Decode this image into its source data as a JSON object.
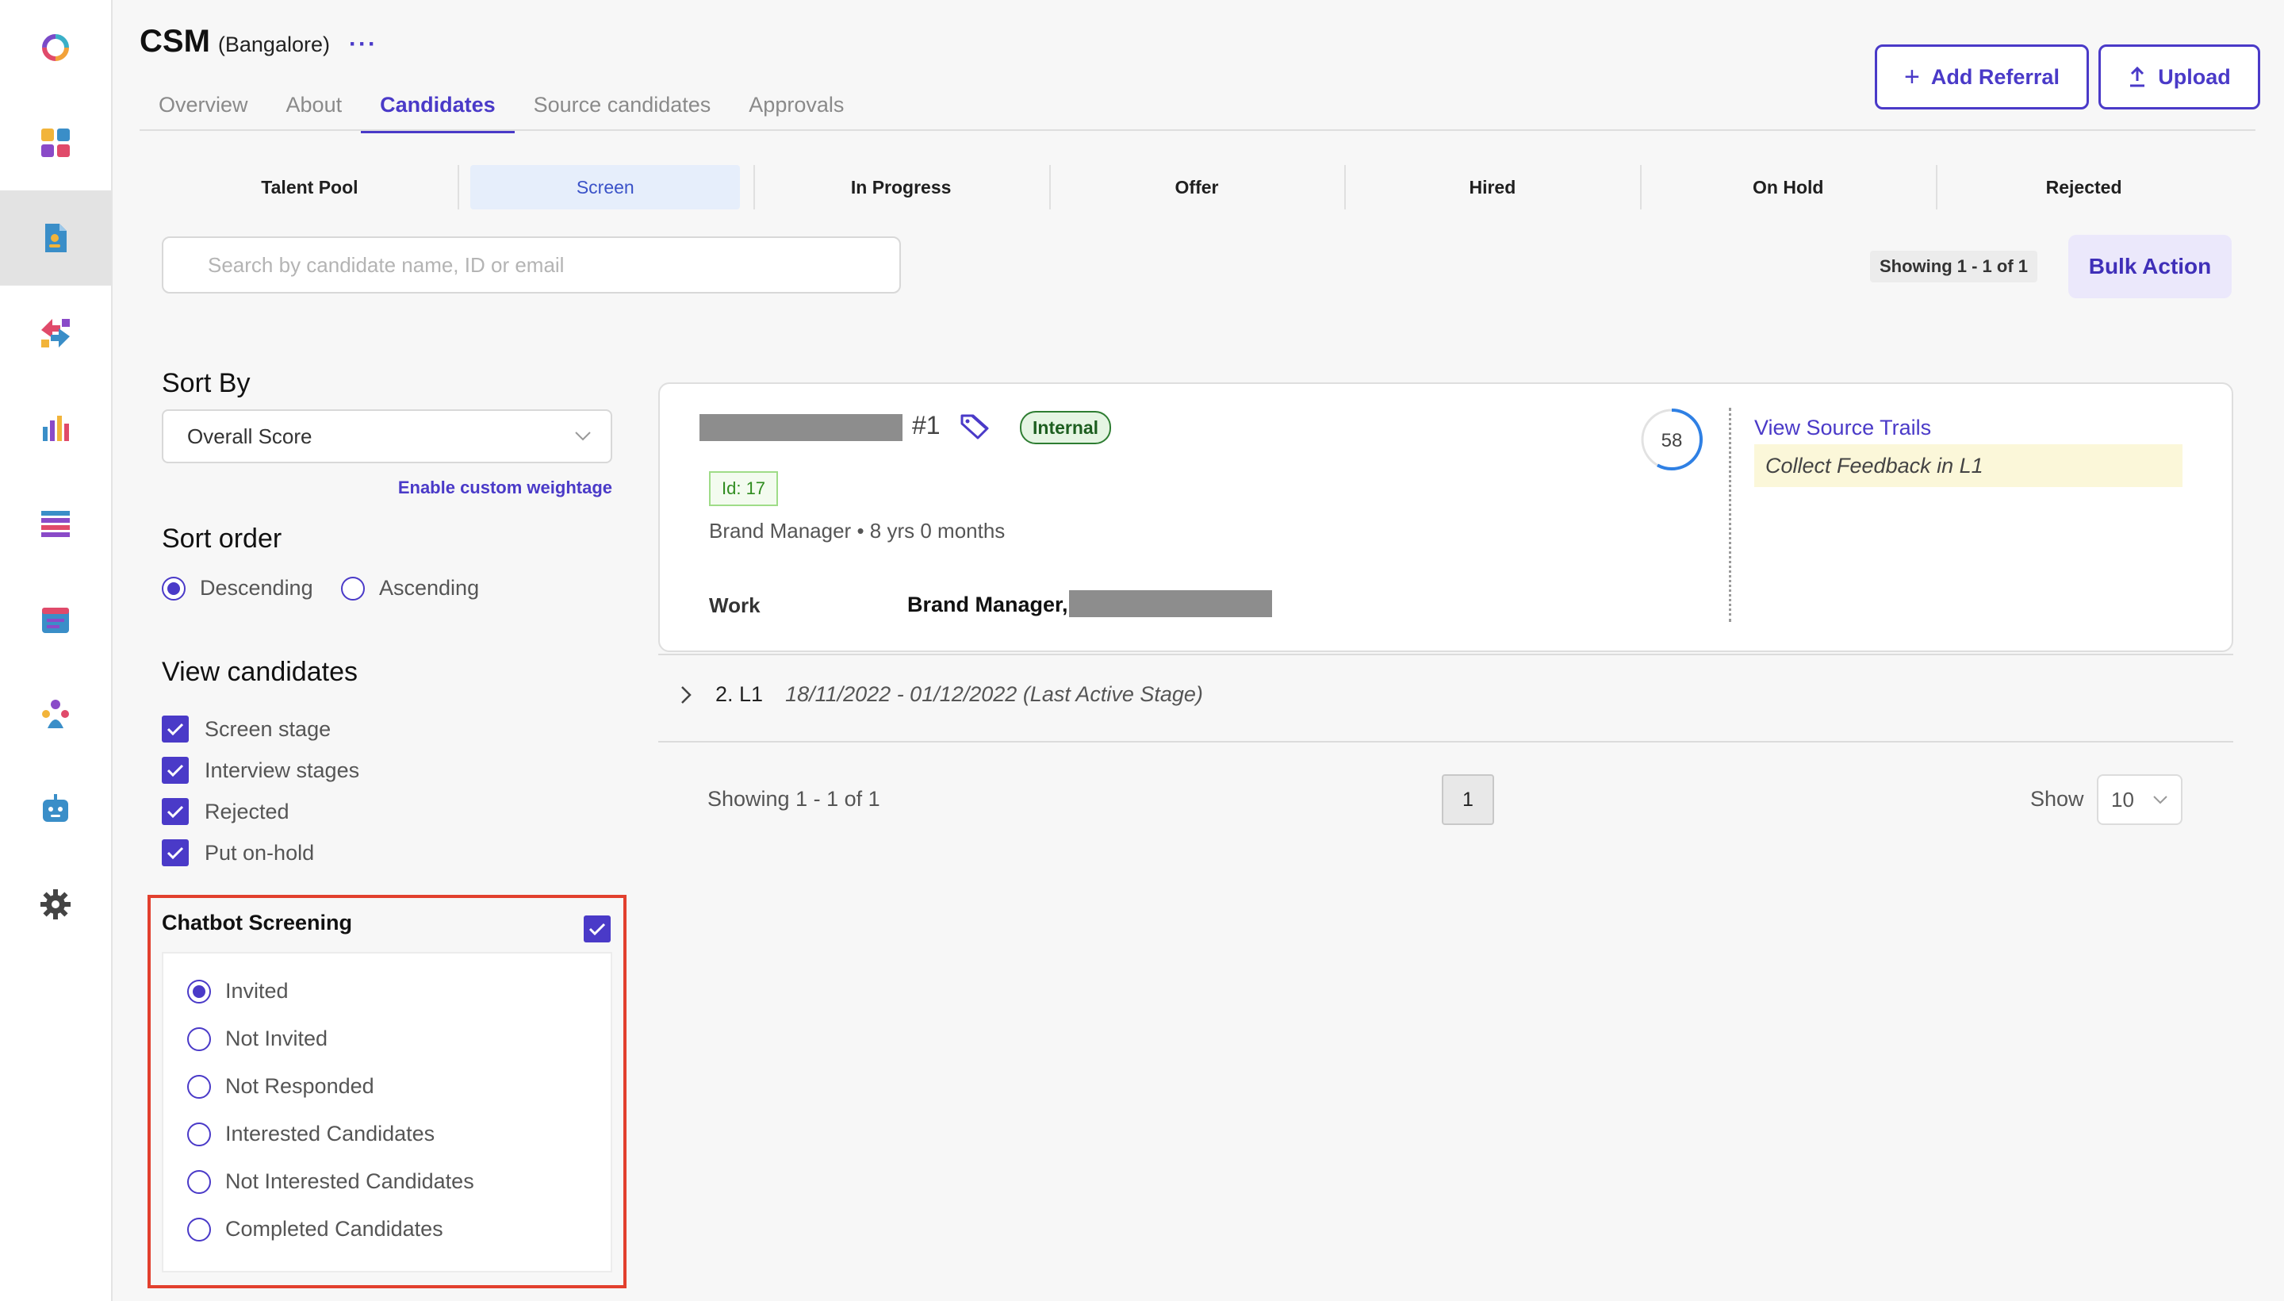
{
  "rail": {
    "items": [
      {
        "name": "logo-icon"
      },
      {
        "name": "dashboard-icon"
      },
      {
        "name": "jobs-icon",
        "active": true
      },
      {
        "name": "referrals-icon"
      },
      {
        "name": "analytics-icon"
      },
      {
        "name": "list-icon"
      },
      {
        "name": "calendar-icon"
      },
      {
        "name": "team-icon"
      },
      {
        "name": "chatbot-icon"
      },
      {
        "name": "settings-icon"
      }
    ]
  },
  "header": {
    "title": "CSM",
    "location": "(Bangalore)",
    "more": "···",
    "add_referral": "Add Referral",
    "upload": "Upload",
    "tabs": [
      {
        "label": "Overview"
      },
      {
        "label": "About"
      },
      {
        "label": "Candidates",
        "active": true
      },
      {
        "label": "Source candidates"
      },
      {
        "label": "Approvals"
      }
    ]
  },
  "stages": [
    {
      "label": "Talent Pool"
    },
    {
      "label": "Screen",
      "active": true
    },
    {
      "label": "In Progress"
    },
    {
      "label": "Offer"
    },
    {
      "label": "Hired"
    },
    {
      "label": "On Hold"
    },
    {
      "label": "Rejected"
    }
  ],
  "search": {
    "placeholder": "Search by candidate name, ID or email",
    "value": ""
  },
  "results": {
    "showing": "Showing 1 - 1 of 1",
    "bulk_action": "Bulk Action"
  },
  "filters": {
    "sort_by_title": "Sort By",
    "sort_by_value": "Overall Score",
    "custom_weightage": "Enable custom weightage",
    "sort_order_title": "Sort order",
    "sort_orders": [
      {
        "label": "Descending",
        "selected": true
      },
      {
        "label": "Ascending",
        "selected": false
      }
    ],
    "view_title": "View candidates",
    "view_options": [
      {
        "label": "Screen stage",
        "checked": true
      },
      {
        "label": "Interview stages",
        "checked": true
      },
      {
        "label": "Rejected",
        "checked": true
      },
      {
        "label": "Put on-hold",
        "checked": true
      }
    ],
    "chatbot_title": "Chatbot Screening",
    "chatbot_checked": true,
    "chatbot_options": [
      {
        "label": "Invited",
        "selected": true
      },
      {
        "label": "Not Invited",
        "selected": false
      },
      {
        "label": "Not Responded",
        "selected": false
      },
      {
        "label": "Interested Candidates",
        "selected": false
      },
      {
        "label": "Not Interested Candidates",
        "selected": false
      },
      {
        "label": "Completed Candidates",
        "selected": false
      }
    ]
  },
  "candidate": {
    "rank": "#1",
    "badge": "Internal",
    "id_label": "Id: 17",
    "role": "Brand Manager",
    "experience": "8 yrs 0 months",
    "score": "58",
    "score_fraction": 0.58,
    "work_label": "Work",
    "work_value": "Brand Manager,",
    "source_trails": "View Source Trails",
    "feedback": "Collect Feedback in L1"
  },
  "stage_history": {
    "label": "2. L1",
    "dates": "18/11/2022 - 01/12/2022 (Last Active Stage)"
  },
  "pagination": {
    "showing": "Showing 1 - 1 of 1",
    "page": "1",
    "show_label": "Show",
    "page_size": "10"
  },
  "colors": {
    "accent": "#4a3ac8",
    "highlight_border": "#e2402e",
    "internal_badge": "#2e7d32"
  }
}
